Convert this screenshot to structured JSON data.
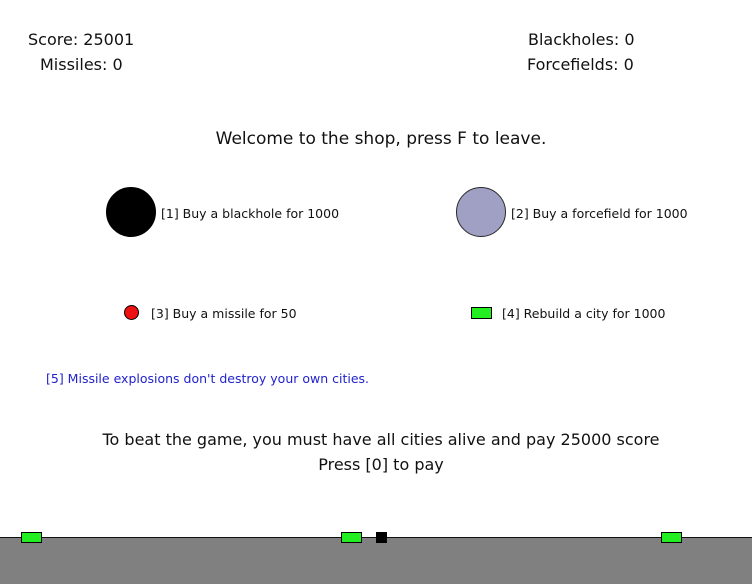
{
  "hud": {
    "score": "Score: 25001",
    "missiles": "Missiles: 0",
    "blackholes": "Blackholes: 0",
    "forcefields": "Forcefields: 0"
  },
  "shop": {
    "welcome": "Welcome to the shop, press F to leave.",
    "items": [
      {
        "label": "[1] Buy a blackhole for 1000",
        "icon": "blackhole-icon",
        "color": "#000000"
      },
      {
        "label": "[2] Buy a forcefield for 1000",
        "icon": "forcefield-icon",
        "color": "#9fa0c4"
      },
      {
        "label": "[3] Buy a missile for 50",
        "icon": "missile-icon",
        "color": "#ee1111"
      },
      {
        "label": "[4] Rebuild a city for 1000",
        "icon": "city-icon",
        "color": "#22ee22"
      }
    ],
    "option5": "[5] Missile explosions don't destroy your own cities.",
    "option5_color": "#2222cc",
    "beat": "To beat the game, you must have all cities alive and pay 25000 score",
    "pay": "Press [0] to pay"
  },
  "scene": {
    "ground_color": "#808080",
    "city_color": "#22ee22",
    "city_count": 3,
    "launcher_color": "#000000"
  }
}
